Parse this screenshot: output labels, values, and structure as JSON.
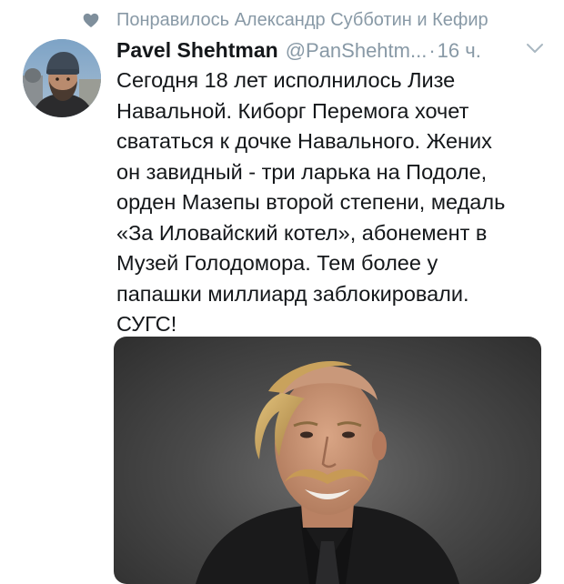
{
  "social_context": {
    "icon": "heart-icon",
    "text": "Понравилось Александр Субботин и Кефир"
  },
  "tweet": {
    "author_name": "Pavel Shehtman",
    "author_handle": "@PanShehtm...",
    "separator": "·",
    "time": "16 ч.",
    "text_lines": [
      "Сегодня 18 лет исполнилось Лизе",
      "Навальной. Киборг Перемога хочет",
      "свататься к дочке Навального. Жених",
      "он завидный - три ларька на Подоле,",
      "орден Мазепы второй степени, медаль",
      "«За Иловайский котел», абонемент в",
      "Музей Голодомора. Тем более у",
      "папашки миллиард заблокировали.",
      "СУГС!"
    ]
  },
  "colors": {
    "text": "#14171a",
    "secondary": "#8899a6",
    "background": "#ffffff"
  }
}
